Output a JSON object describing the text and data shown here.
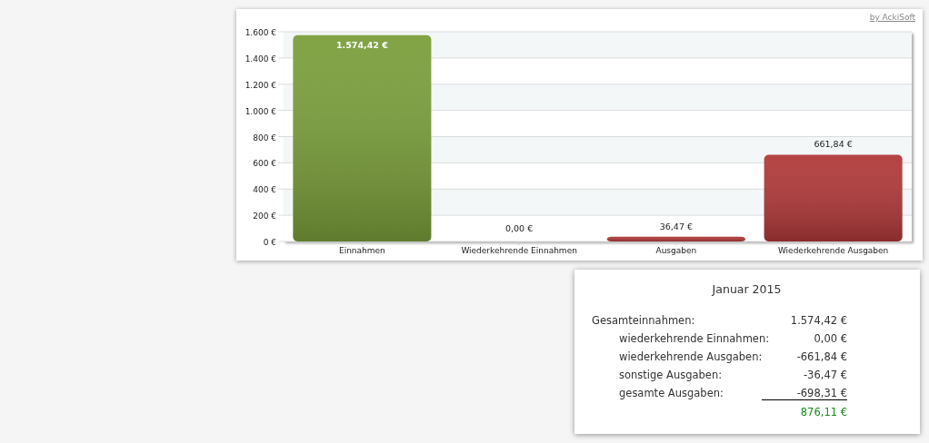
{
  "chart_card": {
    "credit_link": "by AckiSoft",
    "chart_data": {
      "type": "bar",
      "categories": [
        "Einnahmen",
        "Wiederkehrende Einnahmen",
        "Ausgaben",
        "Wiederkehrende Ausgaben"
      ],
      "series": [
        {
          "color": "#7a9e3a",
          "values": [
            1574.42,
            0,
            null,
            null
          ]
        },
        {
          "color": "#b03838",
          "values": [
            null,
            null,
            36.47,
            661.84
          ]
        }
      ],
      "grid": true,
      "ylim": [
        0,
        1600
      ],
      "yticks": [
        {
          "value": 0,
          "label": "0 €"
        },
        {
          "value": 200,
          "label": "200 €"
        },
        {
          "value": 400,
          "label": "400 €"
        },
        {
          "value": 600,
          "label": "600 €"
        },
        {
          "value": 800,
          "label": "800 €"
        },
        {
          "value": 1000,
          "label": "1.000 €"
        },
        {
          "value": 1200,
          "label": "1.200 €"
        },
        {
          "value": 1400,
          "label": "1.400 €"
        },
        {
          "value": 1600,
          "label": "1.600 €"
        }
      ],
      "value_labels": [
        "1.574,42 €",
        "0,00 €",
        "36,47 €",
        "661,84 €"
      ]
    }
  },
  "summary": {
    "title": "Januar 2015",
    "rows": [
      {
        "label": "Gesamteinnahmen:",
        "value": "1.574,42 €",
        "children": [
          {
            "label": "wiederkehrende Einnahmen:",
            "value": "0,00 €",
            "underlined": false
          },
          {
            "label": "wiederkehrende Ausgaben:",
            "value": "-661,84 €",
            "underlined": false
          },
          {
            "label": "sonstige Ausgaben:",
            "value": "-36,47 €",
            "underlined": false
          },
          {
            "label": "gesamte Ausgaben:",
            "value": "-698,31 €",
            "underlined": true
          }
        ]
      }
    ],
    "result": {
      "value": "876,11 €",
      "positive": true
    }
  }
}
